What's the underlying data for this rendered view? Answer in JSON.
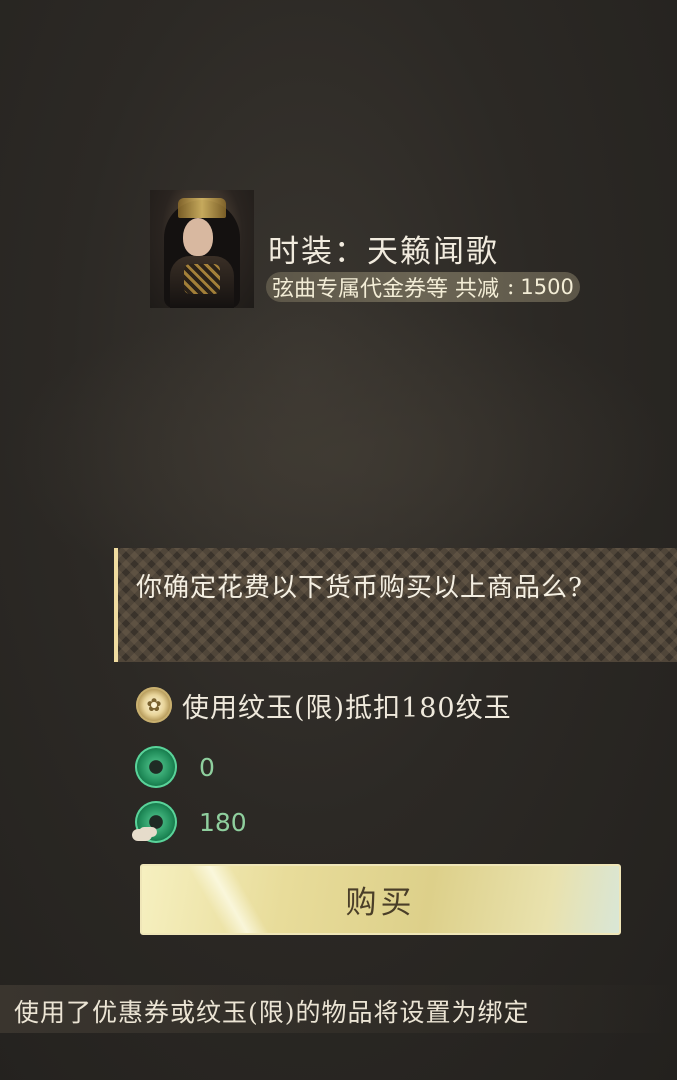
{
  "product": {
    "title": "时装：天籁闻歌",
    "discount_label": "弦曲专属代金券等 共减",
    "discount_amount": "1500"
  },
  "confirm": {
    "question": "你确定花费以下货币购买以上商品么?"
  },
  "coupon_option": {
    "label": "使用纹玉(限)抵扣180纹玉",
    "icon": "coupon-coin-icon"
  },
  "balances": [
    {
      "icon": "jade-coin-icon",
      "value": "0"
    },
    {
      "icon": "bound-jade-coin-icon",
      "value": "180"
    }
  ],
  "buy_button": {
    "label": "购买"
  },
  "notice": {
    "text": "使用了优惠券或纹玉(限)的物品将设置为绑定"
  },
  "colors": {
    "accent_gold": "#f0dca0",
    "jade_green": "#1f8a58",
    "value_green": "#8fcf9e"
  }
}
